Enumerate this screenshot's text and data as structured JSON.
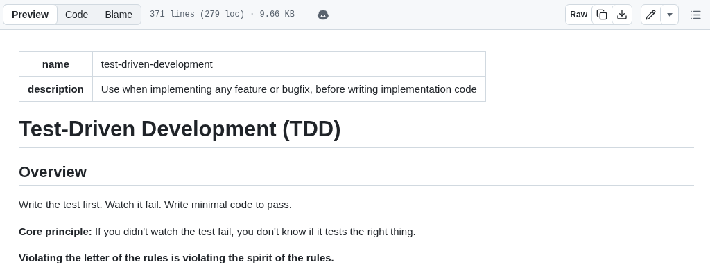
{
  "toolbar": {
    "view_tabs": [
      {
        "label": "Preview",
        "selected": true
      },
      {
        "label": "Code",
        "selected": false
      },
      {
        "label": "Blame",
        "selected": false
      }
    ],
    "file_info": "371 lines (279 loc) · 9.66 KB",
    "raw_button": "Raw"
  },
  "frontmatter": [
    {
      "key": "name",
      "value": "test-driven-development"
    },
    {
      "key": "description",
      "value": "Use when implementing any feature or bugfix, before writing implementation code"
    }
  ],
  "content": [
    {
      "kind": "h1",
      "text": "Test-Driven Development (TDD)"
    },
    {
      "kind": "h2",
      "text": "Overview"
    },
    {
      "kind": "p",
      "text": "Write the test first. Watch it fail. Write minimal code to pass."
    },
    {
      "kind": "p",
      "text": "**Core principle:** If you didn't watch the test fail, you don't know if it tests the right thing."
    },
    {
      "kind": "strong",
      "text": "Violating the letter of the rules is violating the spirit of the rules."
    }
  ]
}
